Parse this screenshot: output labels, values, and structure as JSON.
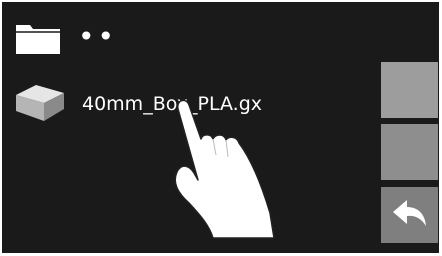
{
  "file_list": {
    "items": [
      {
        "type": "parent-folder",
        "icon": "folder-icon",
        "label": "..",
        "label_shown": "••"
      },
      {
        "type": "file",
        "icon": "box-model-icon",
        "label": "40mm_Box_PLA.gx"
      }
    ]
  },
  "side_buttons": [
    {
      "name": "scroll-up",
      "icon": ""
    },
    {
      "name": "scroll-down",
      "icon": ""
    },
    {
      "name": "back",
      "icon": "back-arrow-icon"
    }
  ],
  "overlay": {
    "icon": "pointing-hand-icon"
  },
  "colors": {
    "screen_bg": "#1a1a1a",
    "text": "#ffffff",
    "button_light": "#9d9d9d",
    "button_mid": "#8e8e8e",
    "button_dark": "#7f7f7f"
  }
}
